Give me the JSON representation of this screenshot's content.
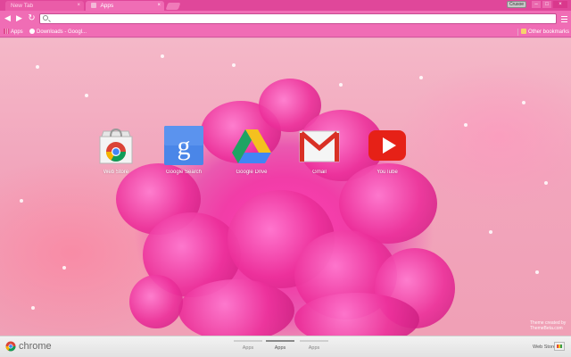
{
  "tabs": [
    {
      "label": "New Tab",
      "active": false
    },
    {
      "label": "Apps",
      "active": true
    }
  ],
  "window": {
    "user_label": "Crusoe",
    "minimize": "–",
    "maximize": "□",
    "close": "×"
  },
  "toolbar": {
    "back": "◀",
    "forward": "▶",
    "reload": "↻",
    "address_value": ""
  },
  "bookmarks": {
    "items": [
      {
        "label": "Apps",
        "icon": "apps-grid-icon"
      },
      {
        "label": "Downloads - Googl...",
        "icon": "google-icon"
      }
    ],
    "other": {
      "label": "Other bookmarks",
      "icon": "folder-icon"
    }
  },
  "apps": [
    {
      "label": "Web Store",
      "icon": "chrome-web-store-icon"
    },
    {
      "label": "Google Search",
      "icon": "google-search-icon"
    },
    {
      "label": "Google Drive",
      "icon": "google-drive-icon"
    },
    {
      "label": "Gmail",
      "icon": "gmail-icon"
    },
    {
      "label": "YouTube",
      "icon": "youtube-icon"
    }
  ],
  "credit": {
    "line1": "Theme created by",
    "line2": "ThemeBeta.com"
  },
  "bottombar": {
    "brand": "chrome",
    "pages": [
      {
        "label": "Apps",
        "active": false
      },
      {
        "label": "Apps",
        "active": true
      },
      {
        "label": "Apps",
        "active": false
      }
    ],
    "webstore_label": "Web Store"
  },
  "colors": {
    "theme_pink": "#f06db5",
    "tabstrip": "#e0479a",
    "bottombar": "#ececec"
  }
}
